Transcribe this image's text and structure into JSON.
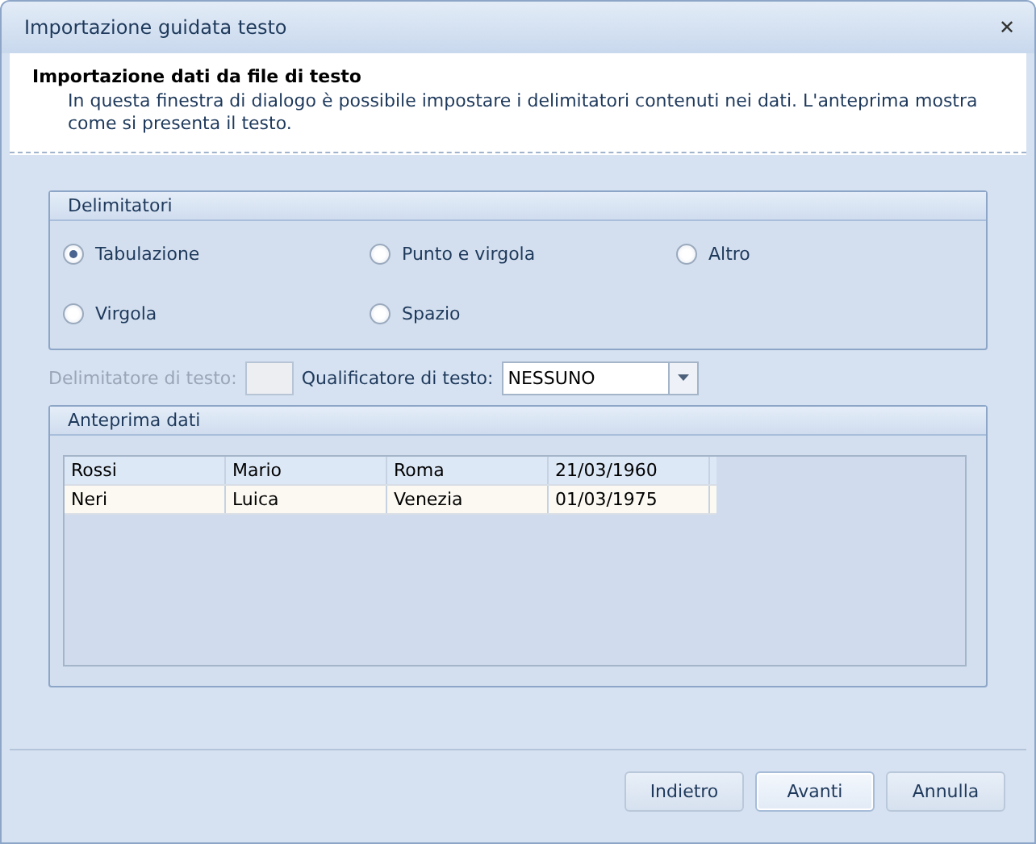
{
  "window": {
    "title": "Importazione guidata testo",
    "close": "✕"
  },
  "header": {
    "title": "Importazione dati da file di testo",
    "description": "In questa finestra di dialogo è possibile impostare i delimitatori contenuti nei dati. L'anteprima mostra come si presenta il testo."
  },
  "delimiters": {
    "title": "Delimitatori",
    "options": [
      {
        "label": "Tabulazione",
        "selected": true
      },
      {
        "label": "Punto e virgola",
        "selected": false
      },
      {
        "label": "Altro",
        "selected": false
      },
      {
        "label": "Virgola",
        "selected": false
      },
      {
        "label": "Spazio",
        "selected": false
      }
    ]
  },
  "text_delimiter": {
    "label": "Delimitatore di testo:",
    "disabled": true
  },
  "text_qualifier": {
    "label": "Qualificatore di testo:",
    "value": "NESSUNO"
  },
  "preview": {
    "title": "Anteprima dati",
    "rows": [
      {
        "selected": true,
        "cells": [
          "Rossi",
          "Mario",
          "Roma",
          "21/03/1960"
        ]
      },
      {
        "selected": false,
        "cells": [
          "Neri",
          "Luica",
          "Venezia",
          "01/03/1975"
        ]
      }
    ]
  },
  "buttons": [
    {
      "label": "Indietro",
      "default": false
    },
    {
      "label": "Avanti",
      "default": true
    },
    {
      "label": "Annulla",
      "default": false
    }
  ]
}
